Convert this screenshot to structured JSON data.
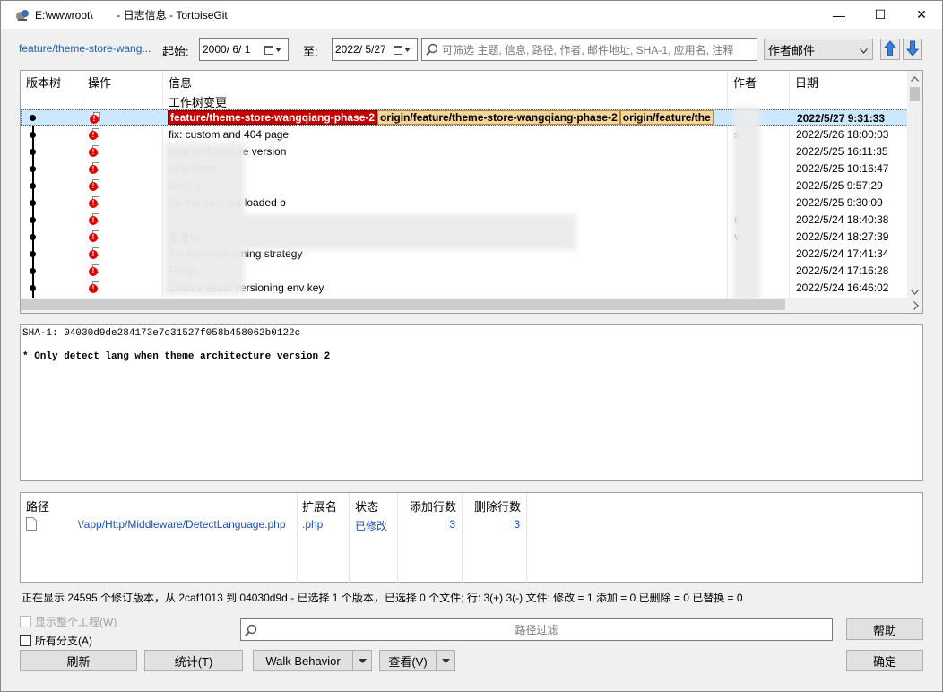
{
  "window": {
    "title": "E:\\wwwroot\\        - 日志信息 - TortoiseGit",
    "minimize": "—",
    "maximize": "☐",
    "close": "✕"
  },
  "toolbar": {
    "branch": "feature/theme-store-wang...",
    "from_label": "起始:",
    "from_date": "2000/  6/  1",
    "to_label": "至:",
    "to_date": "2022/  5/27",
    "search_placeholder": "可筛选 主题, 信息, 路径, 作者, 邮件地址, SHA-1, 应用名, 注释",
    "filter_select": "作者邮件"
  },
  "log": {
    "headers": {
      "tree": "版本树",
      "actions": "操作",
      "message": "信息",
      "author": "作者",
      "date": "日期"
    },
    "wc_changes": "工作树变更",
    "first_row": {
      "tag_local": "feature/theme-store-wangqiang-phase-2",
      "tag_origin": "origin/feature/theme-store-wangqiang-phase-2",
      "tag_origin2": "origin/feature/the",
      "date": "2022/5/27 9:31:33"
    },
    "rows": [
      {
        "message": "fix: custom and 404 page",
        "author": "s",
        "date": "2022/5/26 18:00:03"
      },
      {
        "message": "      eme architecture version",
        "author": "",
        "date": "2022/5/25 16:11:35"
      },
      {
        "message": "              ding slash",
        "author": "",
        "date": "2022/5/25 10:16:47"
      },
      {
        "message": "Set c                                      e",
        "author": "",
        "date": "2022/5/25 9:57:29"
      },
      {
        "message": "Fix the       cale not loaded b",
        "author": "",
        "date": "2022/5/25 9:30:09"
      },
      {
        "message": "",
        "author": "s",
        "date": "2022/5/24 18:40:38"
      },
      {
        "message": "                                                                      录录中",
        "author": "v",
        "date": "2022/5/24 18:27:39"
      },
      {
        "message": "Fix the       asset                  ioning strategy",
        "author": "",
        "date": "2022/5/24 17:41:34"
      },
      {
        "message": "Fix qu",
        "author": "",
        "date": "2022/5/24 17:16:28"
      },
      {
        "message": "Chan             e asset versioning env key",
        "author": "",
        "date": "2022/5/24 16:46:02"
      }
    ]
  },
  "details": {
    "sha_line": "SHA-1: 04030d9de284173e7c31527f058b458062b0122c",
    "message_line": "* Only detect lang when theme architecture version 2"
  },
  "files": {
    "headers": {
      "path": "路径",
      "ext": "扩展名",
      "status": "状态",
      "added": "添加行数",
      "deleted": "删除行数"
    },
    "rows": [
      {
        "path": "\\/app/Http/Middleware/DetectLanguage.php",
        "ext": ".php",
        "status": "已修改",
        "added": "3",
        "deleted": "3"
      }
    ]
  },
  "status_line": "正在显示 24595 个修订版本，从 2caf1013 到 04030d9d - 已选择 1 个版本，已选择 0 个文件; 行: 3(+) 3(-) 文件: 修改 = 1 添加 = 0 已删除 = 0 已替换 = 0",
  "bottom": {
    "show_whole_project": "显示整个工程(W)",
    "all_branches": "所有分支(A)",
    "path_filter_placeholder": "路径过滤",
    "help": "帮助",
    "refresh": "刷新",
    "stats": "统计(T)",
    "walk_behavior": "Walk Behavior",
    "view": "查看(V)",
    "ok": "确定"
  }
}
